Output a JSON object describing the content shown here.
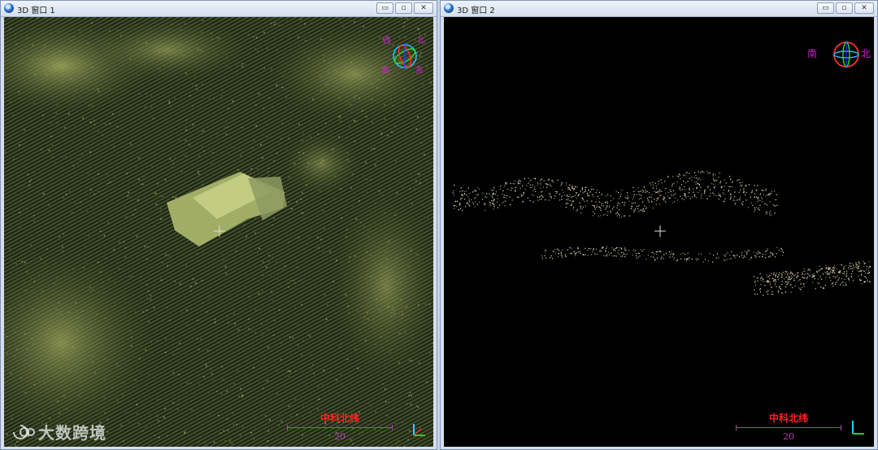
{
  "windows": [
    {
      "title": "3D 窗口 1",
      "controls": {
        "minimize": "▭",
        "restore": "▫",
        "close": "✕"
      },
      "compass": {
        "north": "北",
        "south": "南",
        "east": "东",
        "west": "西"
      },
      "scale": {
        "title": "中科北纬",
        "value": "20"
      }
    },
    {
      "title": "3D 窗口 2",
      "controls": {
        "minimize": "▭",
        "restore": "▫",
        "close": "✕"
      },
      "compass": {
        "north": "北",
        "south": "南"
      },
      "scale": {
        "title": "中科北纬",
        "value": "20"
      }
    }
  ],
  "watermark": {
    "text": "大数跨境"
  },
  "colors": {
    "scale_title": "#ff2222",
    "scale_line": "#b43fb4",
    "compass_label": "#cc22cc",
    "terrain_dark": "#20291a",
    "terrain_light": "#c7c87b"
  }
}
